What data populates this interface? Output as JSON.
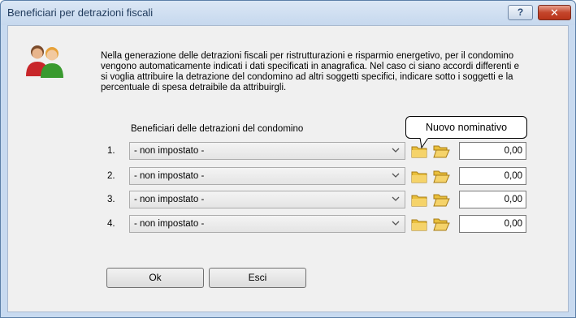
{
  "window": {
    "title": "Beneficiari per detrazioni fiscali",
    "help_label": "?",
    "close_label": "✕"
  },
  "description": "Nella generazione delle detrazioni fiscali per ristrutturazioni e risparmio energetivo, per il condomino vengono automaticamente indicati i dati specificati in anagrafica. Nel caso ci siano accordi differenti e si voglia attribuire la detrazione del condomino ad altri soggetti specifici, indicare sotto i soggetti e la percentuale di spesa detraibile da attribuirgli.",
  "beneficiaries": {
    "header": "Beneficiari delle detrazioni del condomino",
    "rows": [
      {
        "num": "1.",
        "selected": "- non impostato -",
        "amount": "0,00"
      },
      {
        "num": "2.",
        "selected": "- non impostato -",
        "amount": "0,00"
      },
      {
        "num": "3.",
        "selected": "- non impostato -",
        "amount": "0,00"
      },
      {
        "num": "4.",
        "selected": "- non impostato -",
        "amount": "0,00"
      }
    ]
  },
  "tooltip": "Nuovo nominativo",
  "buttons": {
    "ok": "Ok",
    "cancel": "Esci"
  },
  "icons": {
    "users": "users-icon",
    "new": "new-folder-icon",
    "open": "open-folder-icon",
    "dropdown": "chevron-down-icon"
  }
}
